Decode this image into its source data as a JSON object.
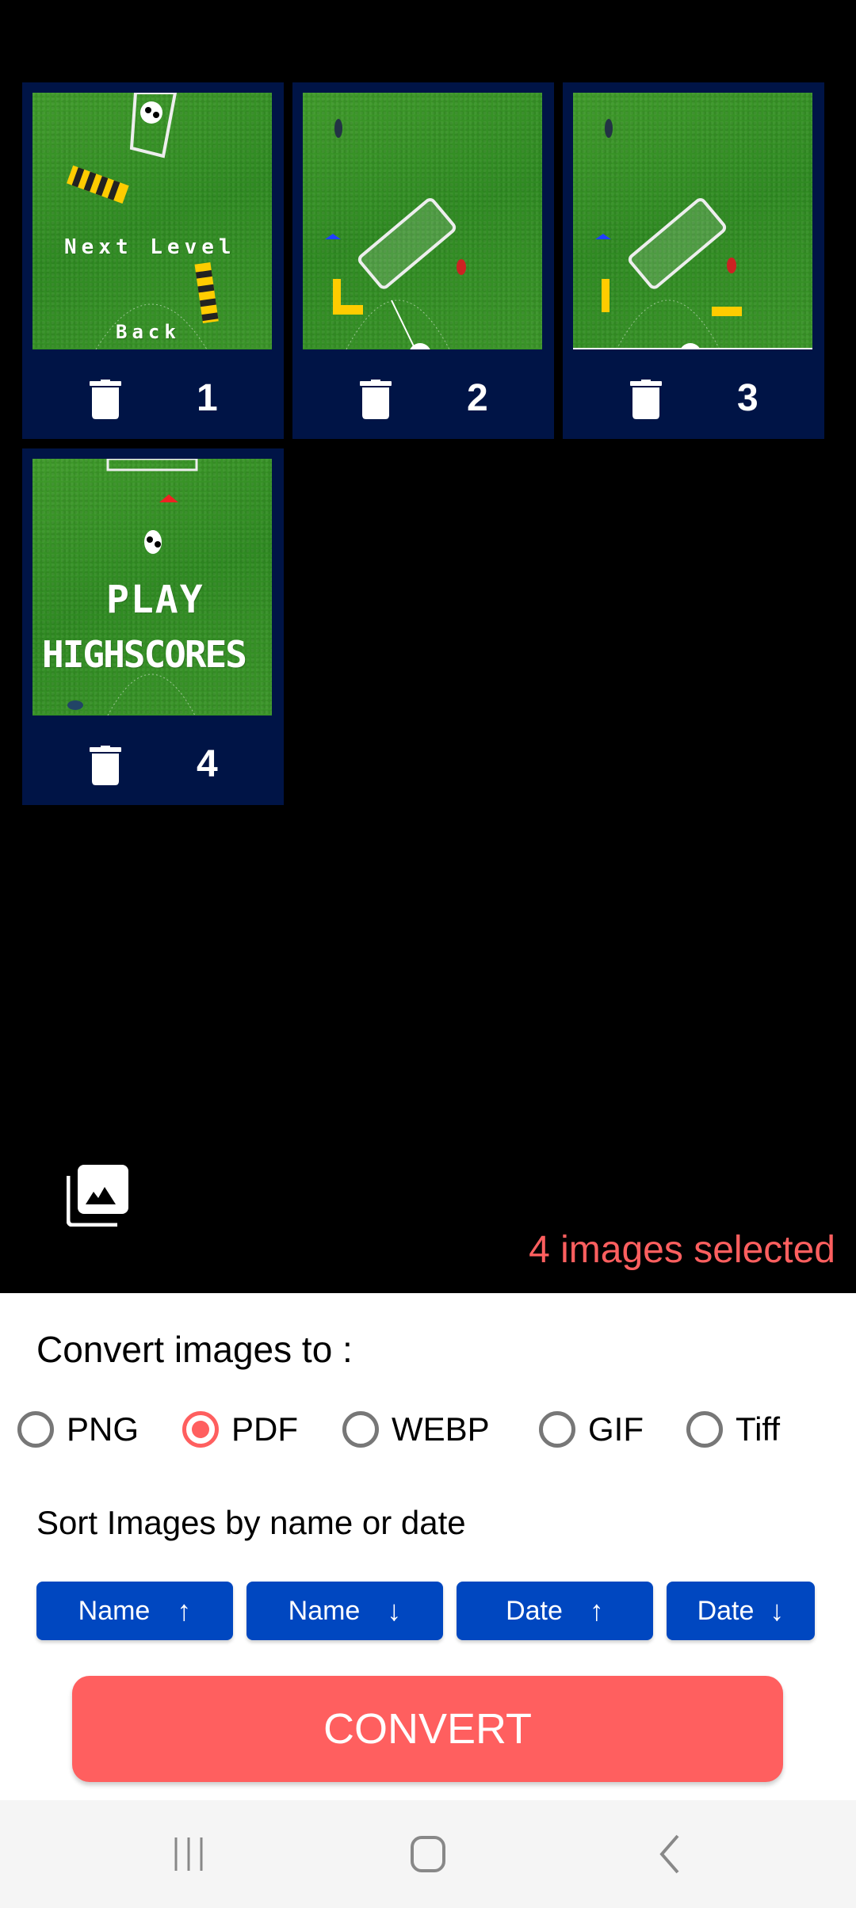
{
  "images": [
    {
      "index": "1",
      "thumbnail": "game-screen-next-level",
      "texts": [
        "Next Level",
        "Back"
      ]
    },
    {
      "index": "2",
      "thumbnail": "game-field-goal",
      "texts": []
    },
    {
      "index": "3",
      "thumbnail": "game-field-goal",
      "texts": []
    },
    {
      "index": "4",
      "thumbnail": "game-screen-menu",
      "texts": [
        "PLAY",
        "HIGHSCORES"
      ]
    }
  ],
  "delete_icon": "trash-icon",
  "gallery_icon": "photo-library-icon",
  "selected_count_text": "4 images selected",
  "convert_panel": {
    "title": "Convert images to :",
    "formats": [
      {
        "label": "PNG",
        "checked": false
      },
      {
        "label": "PDF",
        "checked": true
      },
      {
        "label": "WEBP",
        "checked": false
      },
      {
        "label": "GIF",
        "checked": false
      },
      {
        "label": "Tiff",
        "checked": false
      }
    ],
    "sort_title": "Sort Images by name or date",
    "sort_buttons": [
      {
        "label": "Name",
        "arrow": "↑"
      },
      {
        "label": "Name",
        "arrow": "↓"
      },
      {
        "label": "Date",
        "arrow": "↑"
      },
      {
        "label": "Date",
        "arrow": "↓"
      }
    ],
    "convert_label": "CONVERT"
  },
  "colors": {
    "accent": "#ff5f5f",
    "card": "#001446",
    "sort_button": "#0047c0"
  },
  "navbar": {
    "recents": "recent-apps-icon",
    "home": "home-icon",
    "back": "back-icon"
  }
}
